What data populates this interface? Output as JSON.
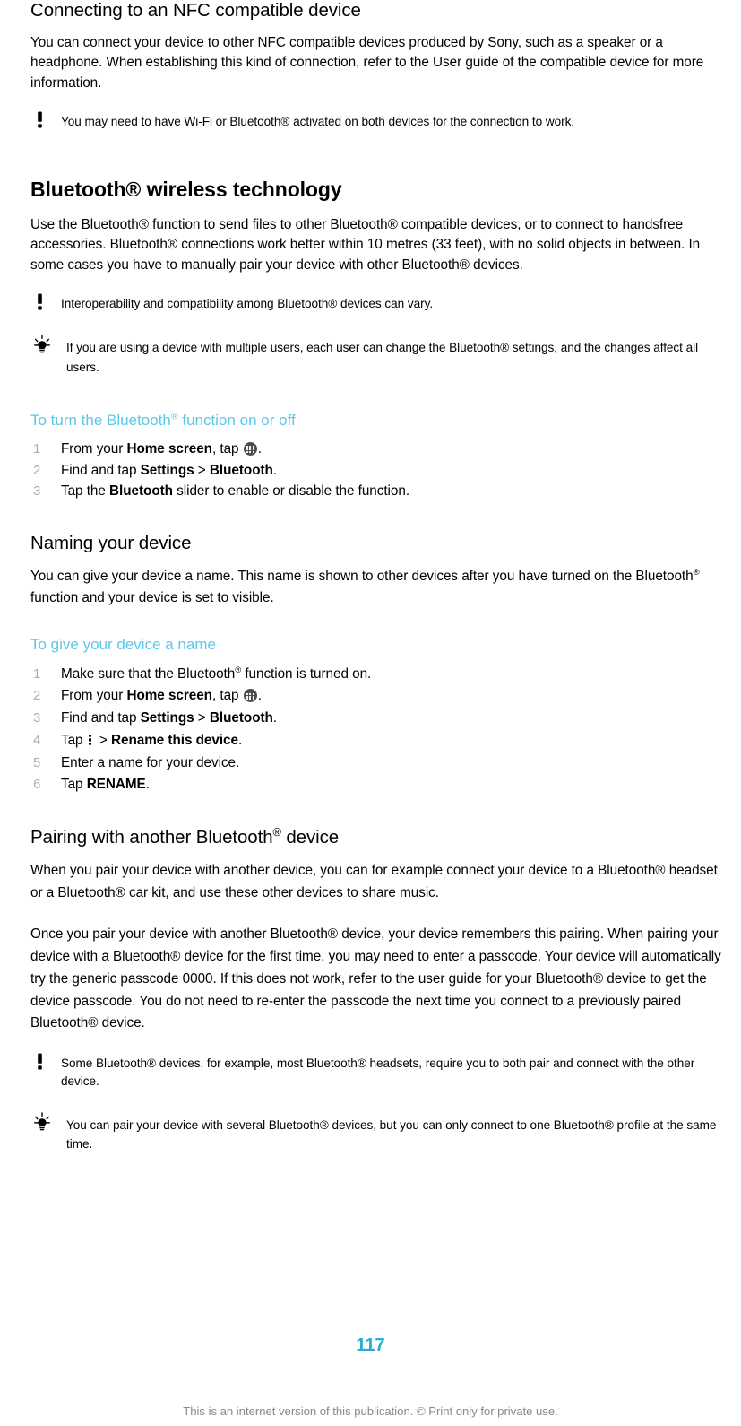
{
  "document": {
    "page_number": "117",
    "footer_note": "This is an internet version of this publication. © Print only for private use.",
    "accent_color": "#5BC8E8",
    "page_number_color": "#29ABD6",
    "step_number_color": "#A8B0B4",
    "footer_note_color": "#8a8a8a"
  },
  "sections": {
    "nfc": {
      "heading": "Connecting to an NFC compatible device",
      "paragraph": "You can connect your device to other NFC compatible devices produced by Sony, such as a speaker or a headphone. When establishing this kind of connection, refer to the User guide of the compatible device for more information.",
      "note": {
        "icon": "warning-icon",
        "text": "You may need to have Wi-Fi or Bluetooth® activated on both devices for the connection to work."
      }
    },
    "bluetooth": {
      "heading_prefix": "Bluetooth",
      "heading_reg": "®",
      "heading_suffix": " wireless technology",
      "paragraph_part1": "Use the Bluetooth® function to send files to other Bluetooth® compatible devices, or to connect to handsfree accessories. Bluetooth® connections work better within 10 metres (33 feet), with no solid objects in between. In some cases you have to manually pair your device with other Bluetooth® devices.",
      "note": {
        "icon": "warning-icon",
        "text": "Interoperability and compatibility among Bluetooth® devices can vary."
      },
      "tip": {
        "icon": "lightbulb-icon",
        "text": "If you are using a device with multiple users, each user can change the Bluetooth® settings, and the changes affect all users."
      },
      "task": {
        "heading_prefix": "To turn the Bluetooth",
        "heading_reg": "®",
        "heading_suffix": " function on or off",
        "steps": [
          {
            "number": "1",
            "text_before": "From your ",
            "bold1": "Home screen",
            "text_mid": ", tap ",
            "icon": "app-drawer-icon",
            "text_after": "."
          },
          {
            "number": "2",
            "text_before": "Find and tap ",
            "bold1": "Settings",
            "text_mid": " > ",
            "bold2": "Bluetooth",
            "text_after": "."
          },
          {
            "number": "3",
            "text_before": "Tap the ",
            "bold1": "Bluetooth",
            "text_after": " slider to enable or disable the function."
          }
        ]
      }
    },
    "naming": {
      "heading": "Naming your device",
      "paragraph_a": "You can give your device a name. This name is shown to other devices after you have turned on the Bluetooth",
      "paragraph_a_reg": "®",
      "paragraph_a_end": " function and your device is set to visible.",
      "task": {
        "heading": "To give your device a name",
        "steps": [
          {
            "number": "1",
            "text_before": "Make sure that the Bluetooth",
            "reg": "®",
            "text_after": " function is turned on."
          },
          {
            "number": "2",
            "text_before": "From your ",
            "bold1": "Home screen",
            "text_mid": ", tap ",
            "icon": "app-drawer-icon",
            "text_after": "."
          },
          {
            "number": "3",
            "text_before": "Find and tap ",
            "bold1": "Settings",
            "text_mid": " > ",
            "bold2": "Bluetooth",
            "text_after": "."
          },
          {
            "number": "4",
            "text_before": "Tap ",
            "icon": "kebab-menu-icon",
            "text_mid": " > ",
            "bold2": "Rename this device",
            "text_after": "."
          },
          {
            "number": "5",
            "text_before": "Enter a name for your device."
          },
          {
            "number": "6",
            "text_before": "Tap ",
            "bold1": "RENAME",
            "text_after": "."
          }
        ]
      }
    },
    "pairing": {
      "heading_prefix": "Pairing with another Bluetooth",
      "heading_reg": "®",
      "heading_suffix": " device",
      "paragraph1": "When you pair your device with another device, you can for example connect your device to a Bluetooth® headset or a Bluetooth® car kit, and use these other devices to share music.",
      "paragraph2": "Once you pair your device with another Bluetooth® device, your device remembers this pairing. When pairing your device with a Bluetooth® device for the first time, you may need to enter a passcode. Your device will automatically try the generic passcode 0000. If this does not work, refer to the user guide for your Bluetooth® device to get the device passcode. You do not need to re-enter the passcode the next time you connect to a previously paired Bluetooth® device.",
      "note": {
        "icon": "warning-icon",
        "text": "Some Bluetooth® devices, for example, most Bluetooth® headsets, require you to both pair and connect with the other device."
      },
      "tip": {
        "icon": "lightbulb-icon",
        "text": "You can pair your device with several Bluetooth® devices, but you can only connect to one Bluetooth® profile at the same time."
      }
    }
  }
}
